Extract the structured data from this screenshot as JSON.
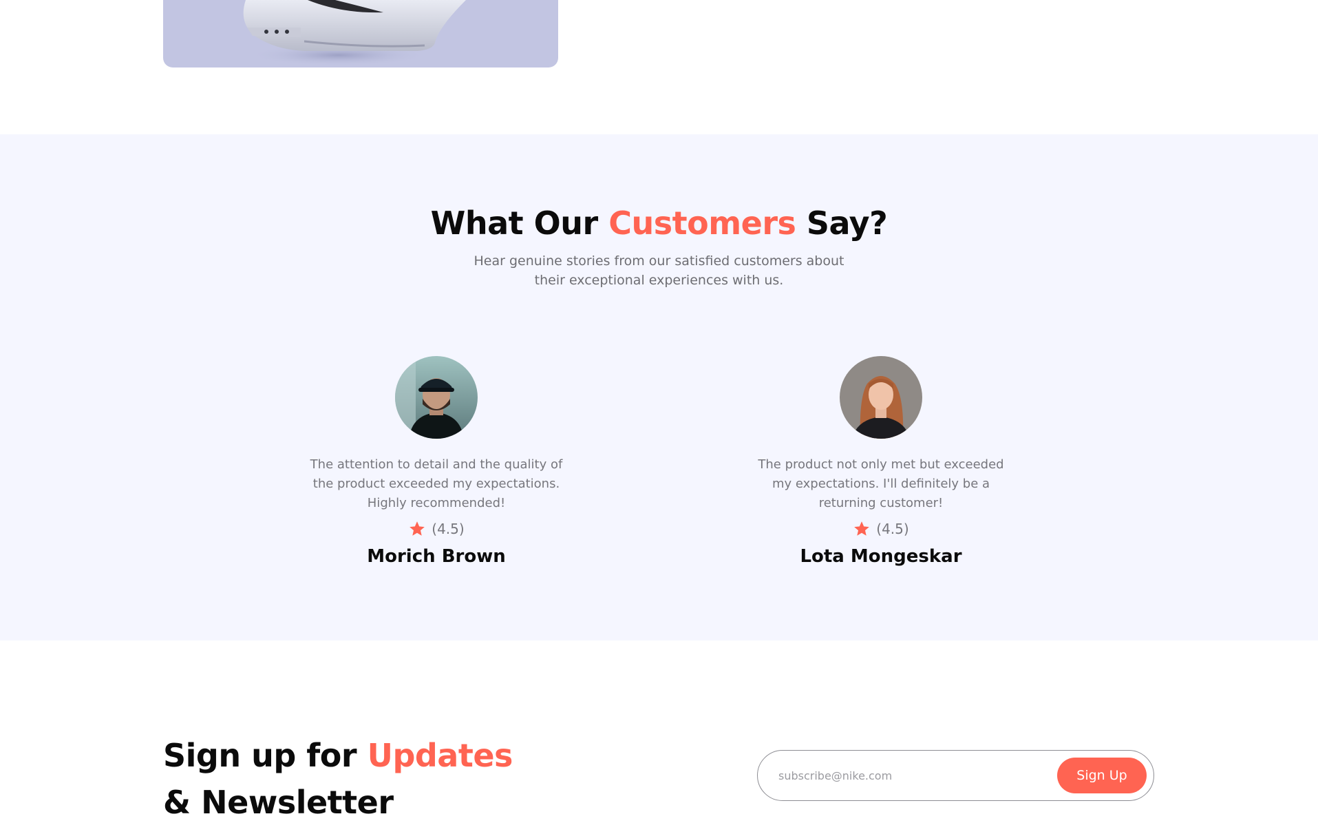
{
  "product_card": {
    "image": "white-sneaker-image",
    "background": "#c2c5e2"
  },
  "reviews": {
    "title_before": "What Our ",
    "title_accent": "Customers",
    "title_after": " Say?",
    "subtitle": "Hear genuine stories from our satisfied customers about their exceptional experiences with us.",
    "items": [
      {
        "avatar": "customer-avatar-man",
        "quote": "The attention to detail and the quality of the product exceeded my expectations. Highly recommended!",
        "rating": "(4.5)",
        "name": "Morich Brown"
      },
      {
        "avatar": "customer-avatar-woman",
        "quote": "The product not only met but exceeded my expectations. I'll definitely be a returning customer!",
        "rating": "(4.5)",
        "name": "Lota Mongeskar"
      }
    ]
  },
  "newsletter": {
    "title_before": "Sign up for ",
    "title_accent": "Updates",
    "title_line2": "& Newsletter",
    "input_placeholder": "subscribe@nike.com",
    "button_label": "Sign Up"
  },
  "colors": {
    "accent": "#ff6452",
    "section_bg": "#f5f6ff",
    "text_dark": "#0b0b0b",
    "text_muted": "#76767c"
  },
  "icons": {
    "rating": "star-icon"
  }
}
